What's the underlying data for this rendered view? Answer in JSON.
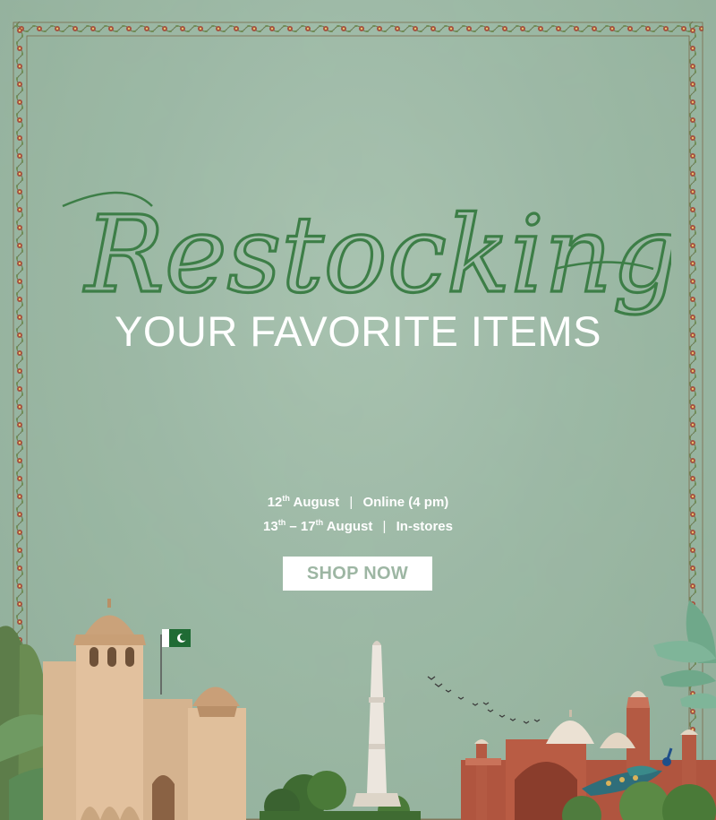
{
  "promo": {
    "script_title": "Restocking",
    "headline": "YOUR FAVORITE ITEMS",
    "online": {
      "day": "12",
      "suffix": "th",
      "month": "August",
      "label": "Online (4 pm)"
    },
    "instore": {
      "day_start": "13",
      "suffix_start": "th",
      "dash": "–",
      "day_end": "17",
      "suffix_end": "th",
      "month": "August",
      "label": "In-stores"
    },
    "separator": "|",
    "cta": "SHOP NOW"
  },
  "colors": {
    "background": "#9cb9a5",
    "script_green": "#3d7e47",
    "headline": "#ffffff",
    "cta_text": "#9db6a3",
    "border_floral": "#8a4a3e"
  },
  "icons": [
    "floral-border-icon",
    "lahore-fort-icon",
    "minar-e-pakistan-icon",
    "badshahi-mosque-icon",
    "pakistan-flag-icon",
    "peacock-icon",
    "birds-icon",
    "palm-leaves-icon"
  ]
}
